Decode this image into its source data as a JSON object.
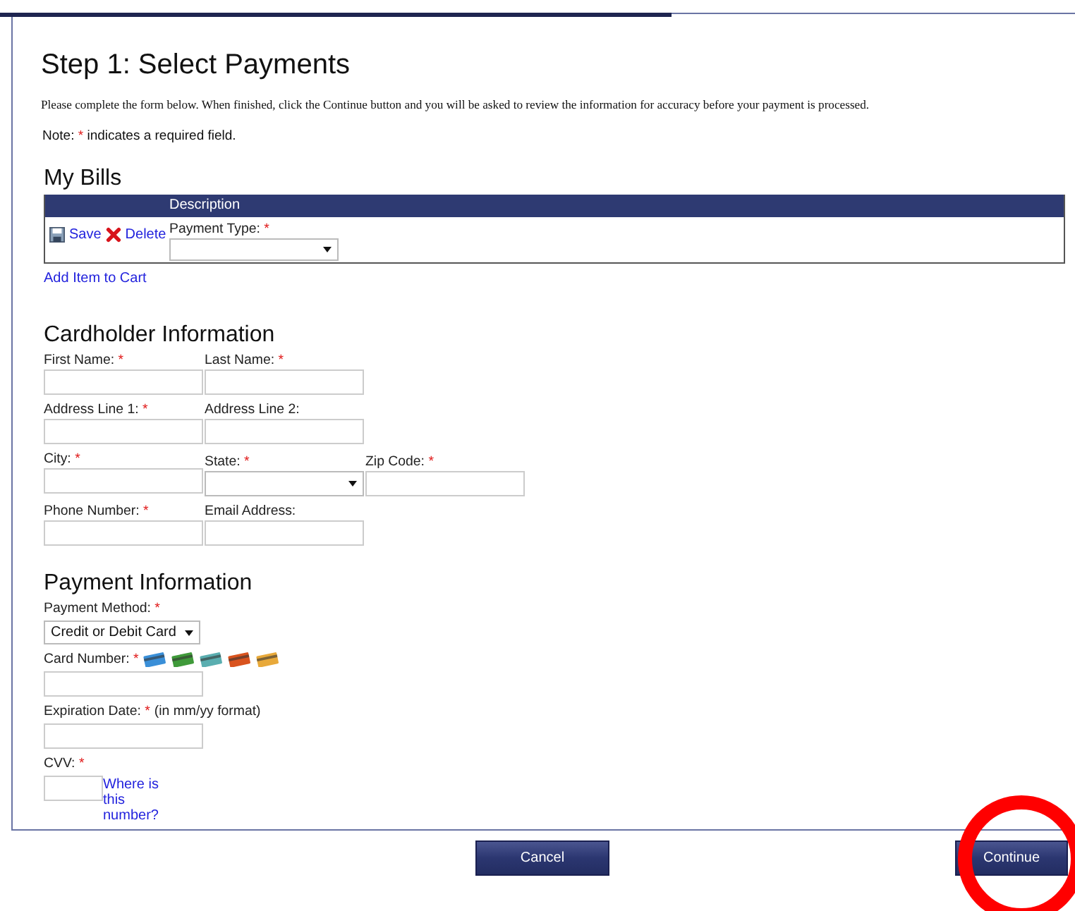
{
  "title": "Step 1: Select Payments",
  "intro": "Please complete the form below. When finished, click the Continue button and you will be asked to review the information for accuracy before your payment is processed.",
  "note": {
    "prefix": "Note:",
    "mark": "*",
    "suffix": "indicates a required field."
  },
  "my_bills": {
    "heading": "My Bills",
    "columns": [
      "Description"
    ],
    "row": {
      "save": "Save",
      "delete": "Delete",
      "field": {
        "label": "Payment Type:",
        "mark": "*",
        "kind": "select"
      }
    },
    "add_link": "Add Item to Cart"
  },
  "cardholder": {
    "heading": "Cardholder Information",
    "rows": [
      [
        {
          "label": "First Name:",
          "mark": "*",
          "kind": "text"
        },
        {
          "label": "Last Name:",
          "mark": "*",
          "kind": "text"
        }
      ],
      [
        {
          "label": "Address Line 1:",
          "mark": "*",
          "kind": "text"
        },
        {
          "label": "Address Line 2:",
          "kind": "text"
        }
      ],
      [
        {
          "label": "City:",
          "mark": "*",
          "kind": "text"
        },
        {
          "label": "State:",
          "mark": "*",
          "kind": "select"
        },
        {
          "label": "Zip Code:",
          "mark": "*",
          "kind": "text"
        }
      ],
      [
        {
          "label": "Phone Number:",
          "mark": "*",
          "kind": "text"
        },
        {
          "label": "Email Address:",
          "kind": "text"
        }
      ]
    ]
  },
  "payment": {
    "heading": "Payment Information",
    "fields": [
      {
        "label": "Payment Method:",
        "mark": "*",
        "kind": "select",
        "value": "Credit or Debit Card"
      },
      {
        "label": "Card Number:",
        "mark": "*",
        "kind": "card"
      },
      {
        "label": "Expiration Date:",
        "mark": "*",
        "hint": "(in mm/yy format)",
        "kind": "text"
      },
      {
        "label": "CVV:",
        "mark": "*",
        "kind": "cvv",
        "link": "Where is this number?"
      }
    ]
  },
  "buttons": [
    {
      "label": "Cancel",
      "highlighted": false
    },
    {
      "label": "Continue",
      "highlighted": true
    }
  ]
}
